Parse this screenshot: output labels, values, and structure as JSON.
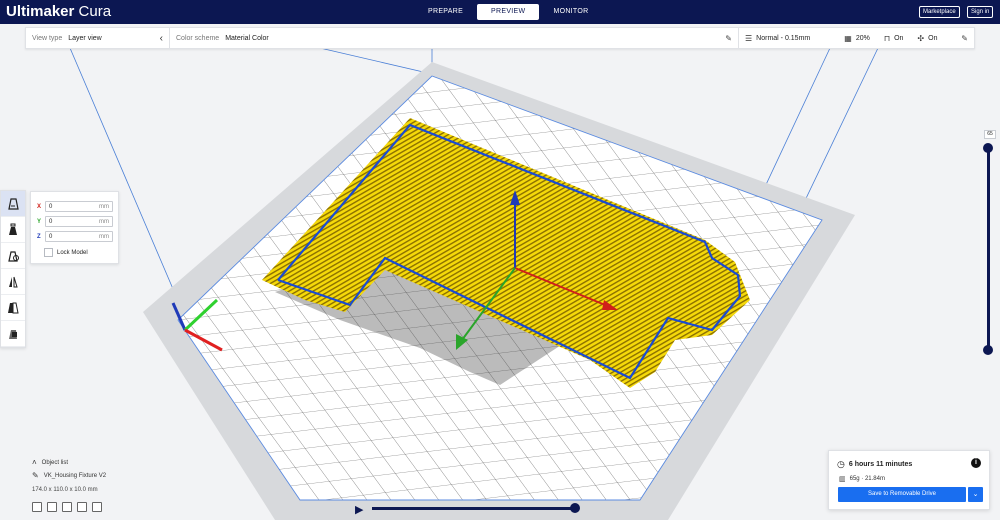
{
  "app": {
    "brand_bold": "Ultimaker",
    "brand_light": "Cura"
  },
  "header": {
    "stages": [
      "PREPARE",
      "PREVIEW",
      "MONITOR"
    ],
    "active_stage": "PREVIEW",
    "marketplace": "Marketplace",
    "signin": "Sign in"
  },
  "settings_bar": {
    "view_type_label": "View type",
    "view_type_value": "Layer view",
    "color_scheme_label": "Color scheme",
    "color_scheme_value": "Material Color",
    "profile": "Normal - 0.15mm",
    "infill": "20%",
    "support": "On",
    "adhesion": "On"
  },
  "move_panel": {
    "x": "0",
    "y": "0",
    "z": "0",
    "unit": "mm",
    "x_label": "X",
    "y_label": "Y",
    "z_label": "Z",
    "lock": "Lock Model"
  },
  "layer_slider": {
    "value": "65"
  },
  "object_list": {
    "title": "Object list",
    "object_name": "VK_Housing Fixture V2",
    "dimensions": "174.0 x 110.0 x 10.0 mm"
  },
  "print": {
    "time": "6 hours 11 minutes",
    "material": "65g · 21.84m",
    "save": "Save to Removable Drive",
    "info": "i"
  },
  "colors": {
    "header": "#0c1752",
    "accent": "#196ef0",
    "part": "#f5d90a",
    "outline": "#1a4bd3"
  }
}
